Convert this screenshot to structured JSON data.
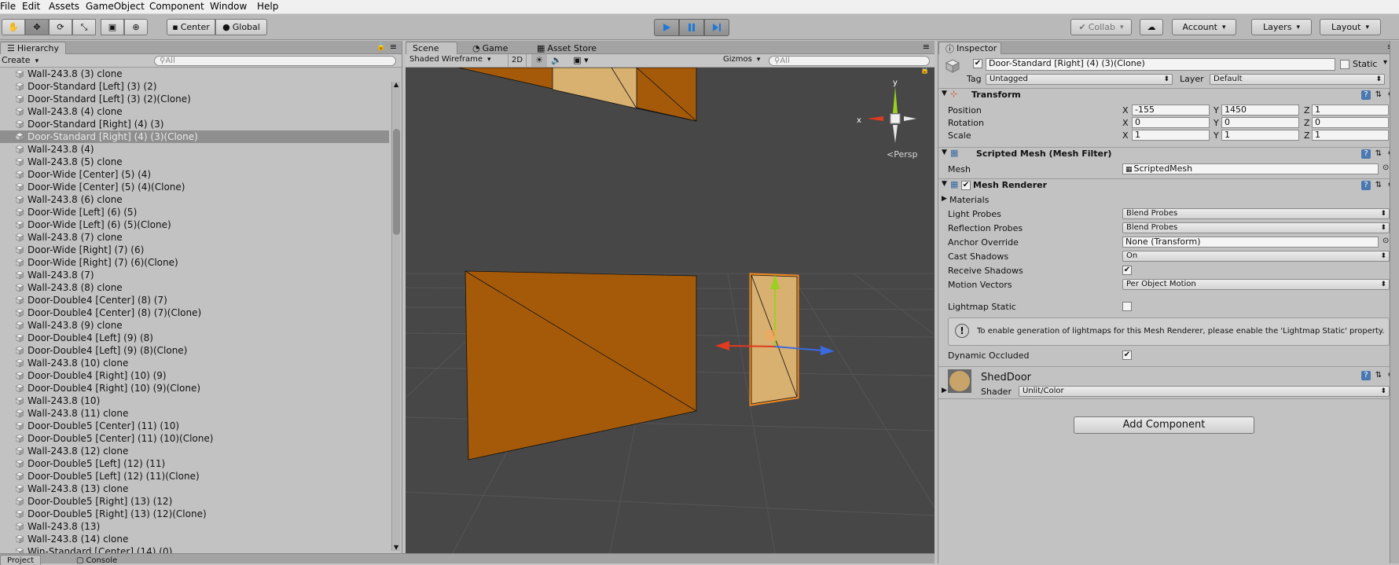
{
  "menu": [
    "File",
    "Edit",
    "Assets",
    "GameObject",
    "Component",
    "Window",
    "Help"
  ],
  "toolbar": {
    "center": "Center",
    "global": "Global",
    "collab": "Collab",
    "account": "Account",
    "layers": "Layers",
    "layout": "Layout"
  },
  "hierarchy": {
    "tab": "Hierarchy",
    "create": "Create",
    "search_placeholder": "All",
    "items": [
      "Wall-243.8 (3) clone",
      "Door-Standard [Left] (3) (2)",
      "Door-Standard [Left] (3) (2)(Clone)",
      "Wall-243.8 (4) clone",
      "Door-Standard [Right] (4) (3)",
      "Door-Standard [Right] (4) (3)(Clone)",
      "Wall-243.8 (4)",
      "Wall-243.8 (5) clone",
      "Door-Wide [Center] (5) (4)",
      "Door-Wide [Center] (5) (4)(Clone)",
      "Wall-243.8 (6) clone",
      "Door-Wide [Left] (6) (5)",
      "Door-Wide [Left] (6) (5)(Clone)",
      "Wall-243.8 (7) clone",
      "Door-Wide [Right] (7) (6)",
      "Door-Wide [Right] (7) (6)(Clone)",
      "Wall-243.8 (7)",
      "Wall-243.8 (8) clone",
      "Door-Double4 [Center] (8) (7)",
      "Door-Double4 [Center] (8) (7)(Clone)",
      "Wall-243.8 (9) clone",
      "Door-Double4 [Left] (9) (8)",
      "Door-Double4 [Left] (9) (8)(Clone)",
      "Wall-243.8 (10) clone",
      "Door-Double4 [Right] (10) (9)",
      "Door-Double4 [Right] (10) (9)(Clone)",
      "Wall-243.8 (10)",
      "Wall-243.8 (11) clone",
      "Door-Double5 [Center] (11) (10)",
      "Door-Double5 [Center] (11) (10)(Clone)",
      "Wall-243.8 (12) clone",
      "Door-Double5 [Left] (12) (11)",
      "Door-Double5 [Left] (12) (11)(Clone)",
      "Wall-243.8 (13) clone",
      "Door-Double5 [Right] (13) (12)",
      "Door-Double5 [Right] (13) (12)(Clone)",
      "Wall-243.8 (13)",
      "Wall-243.8 (14) clone",
      "Win-Standard [Center] (14) (0)"
    ],
    "selected_item": "Door-Standard [Right] (4) (3)(Clone)"
  },
  "scene": {
    "tabs": [
      "Scene",
      "Game",
      "Asset Store"
    ],
    "shading_mode": "Shaded Wireframe",
    "mode_2d": "2D",
    "gizmos": "Gizmos",
    "search_placeholder": "All",
    "persp_label": "Persp",
    "axis_x": "x",
    "axis_y": "y"
  },
  "bottom": {
    "project_tab": "Project",
    "console_tab": "Console"
  },
  "inspector": {
    "tab": "Inspector",
    "object_name": "Door-Standard [Right] (4) (3)(Clone)",
    "static_label": "Static",
    "tag_label": "Tag",
    "tag_value": "Untagged",
    "layer_label": "Layer",
    "layer_value": "Default",
    "transform": {
      "title": "Transform",
      "position_label": "Position",
      "rotation_label": "Rotation",
      "scale_label": "Scale",
      "position": {
        "x": "-155",
        "y": "1450",
        "z": "1"
      },
      "rotation": {
        "x": "0",
        "y": "0",
        "z": "0"
      },
      "scale": {
        "x": "1",
        "y": "1",
        "z": "1"
      },
      "axis_x": "X",
      "axis_y": "Y",
      "axis_z": "Z"
    },
    "mesh_filter": {
      "title": "Scripted Mesh (Mesh Filter)",
      "mesh_label": "Mesh",
      "mesh_value": "ScriptedMesh"
    },
    "mesh_renderer": {
      "title": "Mesh Renderer",
      "materials_label": "Materials",
      "light_probes_label": "Light Probes",
      "light_probes_value": "Blend Probes",
      "reflection_probes_label": "Reflection Probes",
      "reflection_probes_value": "Blend Probes",
      "anchor_override_label": "Anchor Override",
      "anchor_override_value": "None (Transform)",
      "cast_shadows_label": "Cast Shadows",
      "cast_shadows_value": "On",
      "receive_shadows_label": "Receive Shadows",
      "motion_vectors_label": "Motion Vectors",
      "motion_vectors_value": "Per Object Motion",
      "lightmap_static_label": "Lightmap Static",
      "info_text": "To enable generation of lightmaps for this Mesh Renderer, please enable the 'Lightmap Static' property.",
      "dynamic_occluded_label": "Dynamic Occluded"
    },
    "material": {
      "name": "ShedDoor",
      "shader_label": "Shader",
      "shader_value": "Unlit/Color",
      "swatch_color": "#c9a46a"
    },
    "add_component": "Add Component"
  },
  "colors": {
    "wall_orange": "#a55a0a",
    "door_light": "#d8b070",
    "selection_orange": "#f08a20",
    "viewport_bg": "#474747",
    "play_blue": "#1e78d8"
  }
}
